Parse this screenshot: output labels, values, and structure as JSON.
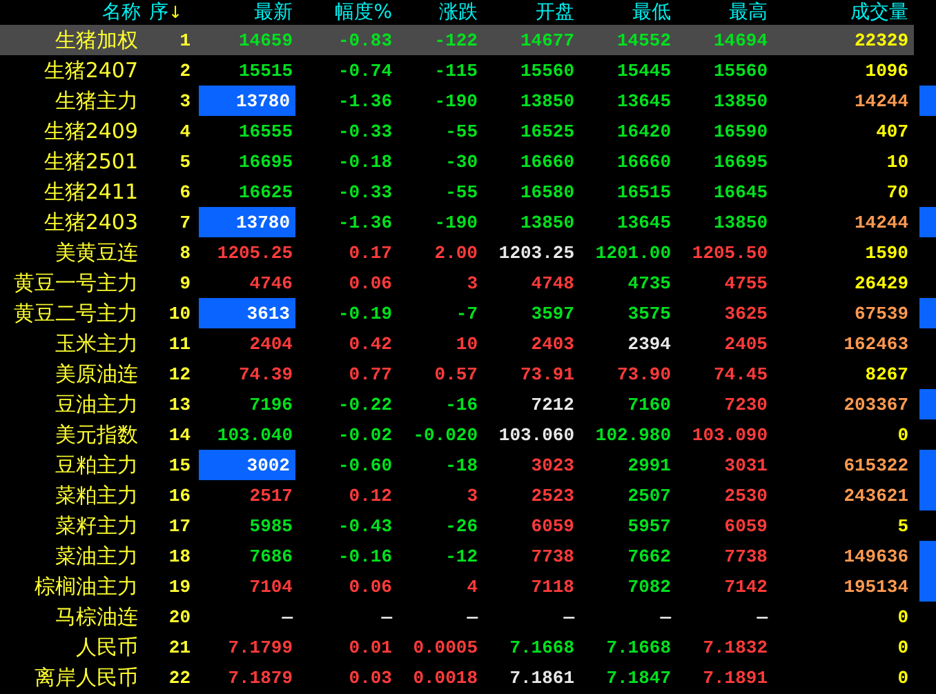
{
  "columns": [
    {
      "label": "名称"
    },
    {
      "label": "序",
      "sort_arrow": "↓"
    },
    {
      "label": "最新"
    },
    {
      "label": "幅度%"
    },
    {
      "label": "涨跌"
    },
    {
      "label": "开盘"
    },
    {
      "label": "最低"
    },
    {
      "label": "最高"
    },
    {
      "label": "成交量"
    }
  ],
  "rows": [
    {
      "name": "生猪加权",
      "seq": "1",
      "selected": true,
      "latest_highlight": false,
      "marker": false,
      "volume": {
        "v": "22329",
        "color": "#ffff00"
      },
      "cells": [
        {
          "v": "14659",
          "color": "#00e11e"
        },
        {
          "v": "-0.83",
          "color": "#00e11e"
        },
        {
          "v": "-122",
          "color": "#00e11e"
        },
        {
          "v": "14677",
          "color": "#00e11e"
        },
        {
          "v": "14552",
          "color": "#00e11e"
        },
        {
          "v": "14694",
          "color": "#00e11e"
        }
      ]
    },
    {
      "name": "生猪2407",
      "seq": "2",
      "selected": false,
      "latest_highlight": false,
      "marker": false,
      "volume": {
        "v": "1096",
        "color": "#ffff00"
      },
      "cells": [
        {
          "v": "15515",
          "color": "#00e11e"
        },
        {
          "v": "-0.74",
          "color": "#00e11e"
        },
        {
          "v": "-115",
          "color": "#00e11e"
        },
        {
          "v": "15560",
          "color": "#00e11e"
        },
        {
          "v": "15445",
          "color": "#00e11e"
        },
        {
          "v": "15560",
          "color": "#00e11e"
        }
      ]
    },
    {
      "name": "生猪主力",
      "seq": "3",
      "selected": false,
      "latest_highlight": true,
      "marker": true,
      "volume": {
        "v": "14244",
        "color": "#ff9a50"
      },
      "cells": [
        {
          "v": "13780",
          "color": "#ffffff"
        },
        {
          "v": "-1.36",
          "color": "#00e11e"
        },
        {
          "v": "-190",
          "color": "#00e11e"
        },
        {
          "v": "13850",
          "color": "#00e11e"
        },
        {
          "v": "13645",
          "color": "#00e11e"
        },
        {
          "v": "13850",
          "color": "#00e11e"
        }
      ]
    },
    {
      "name": "生猪2409",
      "seq": "4",
      "selected": false,
      "latest_highlight": false,
      "marker": false,
      "volume": {
        "v": "407",
        "color": "#ffff00"
      },
      "cells": [
        {
          "v": "16555",
          "color": "#00e11e"
        },
        {
          "v": "-0.33",
          "color": "#00e11e"
        },
        {
          "v": "-55",
          "color": "#00e11e"
        },
        {
          "v": "16525",
          "color": "#00e11e"
        },
        {
          "v": "16420",
          "color": "#00e11e"
        },
        {
          "v": "16590",
          "color": "#00e11e"
        }
      ]
    },
    {
      "name": "生猪2501",
      "seq": "5",
      "selected": false,
      "latest_highlight": false,
      "marker": false,
      "volume": {
        "v": "10",
        "color": "#ffff00"
      },
      "cells": [
        {
          "v": "16695",
          "color": "#00e11e"
        },
        {
          "v": "-0.18",
          "color": "#00e11e"
        },
        {
          "v": "-30",
          "color": "#00e11e"
        },
        {
          "v": "16660",
          "color": "#00e11e"
        },
        {
          "v": "16660",
          "color": "#00e11e"
        },
        {
          "v": "16695",
          "color": "#00e11e"
        }
      ]
    },
    {
      "name": "生猪2411",
      "seq": "6",
      "selected": false,
      "latest_highlight": false,
      "marker": false,
      "volume": {
        "v": "70",
        "color": "#ffff00"
      },
      "cells": [
        {
          "v": "16625",
          "color": "#00e11e"
        },
        {
          "v": "-0.33",
          "color": "#00e11e"
        },
        {
          "v": "-55",
          "color": "#00e11e"
        },
        {
          "v": "16580",
          "color": "#00e11e"
        },
        {
          "v": "16515",
          "color": "#00e11e"
        },
        {
          "v": "16645",
          "color": "#00e11e"
        }
      ]
    },
    {
      "name": "生猪2403",
      "seq": "7",
      "selected": false,
      "latest_highlight": true,
      "marker": true,
      "volume": {
        "v": "14244",
        "color": "#ff9a50"
      },
      "cells": [
        {
          "v": "13780",
          "color": "#ffffff"
        },
        {
          "v": "-1.36",
          "color": "#00e11e"
        },
        {
          "v": "-190",
          "color": "#00e11e"
        },
        {
          "v": "13850",
          "color": "#00e11e"
        },
        {
          "v": "13645",
          "color": "#00e11e"
        },
        {
          "v": "13850",
          "color": "#00e11e"
        }
      ]
    },
    {
      "name": "美黄豆连",
      "seq": "8",
      "selected": false,
      "latest_highlight": false,
      "marker": false,
      "volume": {
        "v": "1590",
        "color": "#ffff00"
      },
      "cells": [
        {
          "v": "1205.25",
          "color": "#ff3b3b"
        },
        {
          "v": "0.17",
          "color": "#ff3b3b"
        },
        {
          "v": "2.00",
          "color": "#ff3b3b"
        },
        {
          "v": "1203.25",
          "color": "#e8e8e8"
        },
        {
          "v": "1201.00",
          "color": "#00e11e"
        },
        {
          "v": "1205.50",
          "color": "#ff3b3b"
        }
      ]
    },
    {
      "name": "黄豆一号主力",
      "seq": "9",
      "selected": false,
      "latest_highlight": false,
      "marker": false,
      "volume": {
        "v": "26429",
        "color": "#ffff00"
      },
      "cells": [
        {
          "v": "4746",
          "color": "#ff3b3b"
        },
        {
          "v": "0.06",
          "color": "#ff3b3b"
        },
        {
          "v": "3",
          "color": "#ff3b3b"
        },
        {
          "v": "4748",
          "color": "#ff3b3b"
        },
        {
          "v": "4735",
          "color": "#00e11e"
        },
        {
          "v": "4755",
          "color": "#ff3b3b"
        }
      ]
    },
    {
      "name": "黄豆二号主力",
      "seq": "10",
      "selected": false,
      "latest_highlight": true,
      "marker": true,
      "volume": {
        "v": "67539",
        "color": "#ff9a50"
      },
      "cells": [
        {
          "v": "3613",
          "color": "#ffffff"
        },
        {
          "v": "-0.19",
          "color": "#00e11e"
        },
        {
          "v": "-7",
          "color": "#00e11e"
        },
        {
          "v": "3597",
          "color": "#00e11e"
        },
        {
          "v": "3575",
          "color": "#00e11e"
        },
        {
          "v": "3625",
          "color": "#ff3b3b"
        }
      ]
    },
    {
      "name": "玉米主力",
      "seq": "11",
      "selected": false,
      "latest_highlight": false,
      "marker": false,
      "volume": {
        "v": "162463",
        "color": "#ff9a50"
      },
      "cells": [
        {
          "v": "2404",
          "color": "#ff3b3b"
        },
        {
          "v": "0.42",
          "color": "#ff3b3b"
        },
        {
          "v": "10",
          "color": "#ff3b3b"
        },
        {
          "v": "2403",
          "color": "#ff3b3b"
        },
        {
          "v": "2394",
          "color": "#e8e8e8"
        },
        {
          "v": "2405",
          "color": "#ff3b3b"
        }
      ]
    },
    {
      "name": "美原油连",
      "seq": "12",
      "selected": false,
      "latest_highlight": false,
      "marker": false,
      "volume": {
        "v": "8267",
        "color": "#ffff00"
      },
      "cells": [
        {
          "v": "74.39",
          "color": "#ff3b3b"
        },
        {
          "v": "0.77",
          "color": "#ff3b3b"
        },
        {
          "v": "0.57",
          "color": "#ff3b3b"
        },
        {
          "v": "73.91",
          "color": "#ff3b3b"
        },
        {
          "v": "73.90",
          "color": "#ff3b3b"
        },
        {
          "v": "74.45",
          "color": "#ff3b3b"
        }
      ]
    },
    {
      "name": "豆油主力",
      "seq": "13",
      "selected": false,
      "latest_highlight": false,
      "marker": true,
      "volume": {
        "v": "203367",
        "color": "#ff9a50"
      },
      "cells": [
        {
          "v": "7196",
          "color": "#00e11e"
        },
        {
          "v": "-0.22",
          "color": "#00e11e"
        },
        {
          "v": "-16",
          "color": "#00e11e"
        },
        {
          "v": "7212",
          "color": "#e8e8e8"
        },
        {
          "v": "7160",
          "color": "#00e11e"
        },
        {
          "v": "7230",
          "color": "#ff3b3b"
        }
      ]
    },
    {
      "name": "美元指数",
      "seq": "14",
      "selected": false,
      "latest_highlight": false,
      "marker": false,
      "volume": {
        "v": "0",
        "color": "#ffff00"
      },
      "cells": [
        {
          "v": "103.040",
          "color": "#00e11e"
        },
        {
          "v": "-0.02",
          "color": "#00e11e"
        },
        {
          "v": "-0.020",
          "color": "#00e11e"
        },
        {
          "v": "103.060",
          "color": "#e8e8e8"
        },
        {
          "v": "102.980",
          "color": "#00e11e"
        },
        {
          "v": "103.090",
          "color": "#ff3b3b"
        }
      ]
    },
    {
      "name": "豆粕主力",
      "seq": "15",
      "selected": false,
      "latest_highlight": true,
      "marker": true,
      "volume": {
        "v": "615322",
        "color": "#ff9a50"
      },
      "cells": [
        {
          "v": "3002",
          "color": "#ffffff"
        },
        {
          "v": "-0.60",
          "color": "#00e11e"
        },
        {
          "v": "-18",
          "color": "#00e11e"
        },
        {
          "v": "3023",
          "color": "#ff3b3b"
        },
        {
          "v": "2991",
          "color": "#00e11e"
        },
        {
          "v": "3031",
          "color": "#ff3b3b"
        }
      ]
    },
    {
      "name": "菜粕主力",
      "seq": "16",
      "selected": false,
      "latest_highlight": false,
      "marker": true,
      "volume": {
        "v": "243621",
        "color": "#ff9a50"
      },
      "cells": [
        {
          "v": "2517",
          "color": "#ff3b3b"
        },
        {
          "v": "0.12",
          "color": "#ff3b3b"
        },
        {
          "v": "3",
          "color": "#ff3b3b"
        },
        {
          "v": "2523",
          "color": "#ff3b3b"
        },
        {
          "v": "2507",
          "color": "#00e11e"
        },
        {
          "v": "2530",
          "color": "#ff3b3b"
        }
      ]
    },
    {
      "name": "菜籽主力",
      "seq": "17",
      "selected": false,
      "latest_highlight": false,
      "marker": false,
      "volume": {
        "v": "5",
        "color": "#ffff00"
      },
      "cells": [
        {
          "v": "5985",
          "color": "#00e11e"
        },
        {
          "v": "-0.43",
          "color": "#00e11e"
        },
        {
          "v": "-26",
          "color": "#00e11e"
        },
        {
          "v": "6059",
          "color": "#ff3b3b"
        },
        {
          "v": "5957",
          "color": "#00e11e"
        },
        {
          "v": "6059",
          "color": "#ff3b3b"
        }
      ]
    },
    {
      "name": "菜油主力",
      "seq": "18",
      "selected": false,
      "latest_highlight": false,
      "marker": true,
      "volume": {
        "v": "149636",
        "color": "#ff9a50"
      },
      "cells": [
        {
          "v": "7686",
          "color": "#00e11e"
        },
        {
          "v": "-0.16",
          "color": "#00e11e"
        },
        {
          "v": "-12",
          "color": "#00e11e"
        },
        {
          "v": "7738",
          "color": "#ff3b3b"
        },
        {
          "v": "7662",
          "color": "#00e11e"
        },
        {
          "v": "7738",
          "color": "#ff3b3b"
        }
      ]
    },
    {
      "name": "棕榈油主力",
      "seq": "19",
      "selected": false,
      "latest_highlight": false,
      "marker": true,
      "volume": {
        "v": "195134",
        "color": "#ff9a50"
      },
      "cells": [
        {
          "v": "7104",
          "color": "#ff3b3b"
        },
        {
          "v": "0.06",
          "color": "#ff3b3b"
        },
        {
          "v": "4",
          "color": "#ff3b3b"
        },
        {
          "v": "7118",
          "color": "#ff3b3b"
        },
        {
          "v": "7082",
          "color": "#00e11e"
        },
        {
          "v": "7142",
          "color": "#ff3b3b"
        }
      ]
    },
    {
      "name": "马棕油连",
      "seq": "20",
      "selected": false,
      "latest_highlight": false,
      "marker": false,
      "volume": {
        "v": "0",
        "color": "#ffff00"
      },
      "cells": [
        {
          "v": "—",
          "color": "#e8e8e8"
        },
        {
          "v": "—",
          "color": "#e8e8e8"
        },
        {
          "v": "—",
          "color": "#e8e8e8"
        },
        {
          "v": "—",
          "color": "#e8e8e8"
        },
        {
          "v": "—",
          "color": "#e8e8e8"
        },
        {
          "v": "—",
          "color": "#e8e8e8"
        }
      ]
    },
    {
      "name": "人民币",
      "seq": "21",
      "selected": false,
      "latest_highlight": false,
      "marker": false,
      "volume": {
        "v": "0",
        "color": "#ffff00"
      },
      "cells": [
        {
          "v": "7.1799",
          "color": "#ff3b3b"
        },
        {
          "v": "0.01",
          "color": "#ff3b3b"
        },
        {
          "v": "0.0005",
          "color": "#ff3b3b"
        },
        {
          "v": "7.1668",
          "color": "#00e11e"
        },
        {
          "v": "7.1668",
          "color": "#00e11e"
        },
        {
          "v": "7.1832",
          "color": "#ff3b3b"
        }
      ]
    },
    {
      "name": "离岸人民币",
      "seq": "22",
      "selected": false,
      "latest_highlight": false,
      "marker": false,
      "volume": {
        "v": "0",
        "color": "#ffff00"
      },
      "cells": [
        {
          "v": "7.1879",
          "color": "#ff3b3b"
        },
        {
          "v": "0.03",
          "color": "#ff3b3b"
        },
        {
          "v": "0.0018",
          "color": "#ff3b3b"
        },
        {
          "v": "7.1861",
          "color": "#e8e8e8"
        },
        {
          "v": "7.1847",
          "color": "#00e11e"
        },
        {
          "v": "7.1891",
          "color": "#ff3b3b"
        }
      ]
    }
  ]
}
